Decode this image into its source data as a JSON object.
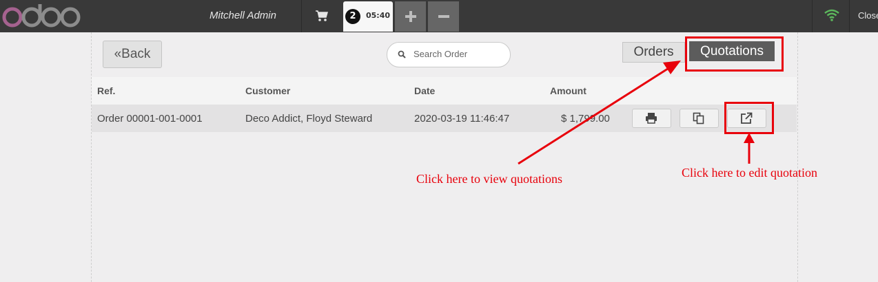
{
  "topbar": {
    "logo_text": "odoo",
    "cashier": "Mitchell Admin",
    "order_badge": "2",
    "order_time": "05:40",
    "close_label": "Close"
  },
  "toolbar": {
    "back_label": "Back",
    "search_placeholder": "Search Order",
    "orders_label": "Orders",
    "quotations_label": "Quotations"
  },
  "table": {
    "headers": [
      "Ref.",
      "Customer",
      "Date",
      "Amount"
    ],
    "rows": [
      {
        "ref": "Order 00001-001-0001",
        "customer": "Deco Addict, Floyd Steward",
        "date": "2020-03-19 11:46:47",
        "amount": "$ 1,799.00"
      }
    ]
  },
  "annotations": {
    "view_quotations": "Click here to view quotations",
    "edit_quotation": "Click here to edit quotation",
    "color": "#e8000b"
  },
  "icons": [
    "cart-icon",
    "plus-icon",
    "minus-icon",
    "wifi-icon",
    "search-icon",
    "print-icon",
    "copy-icon",
    "external-link-icon",
    "double-chevron-left-icon"
  ]
}
